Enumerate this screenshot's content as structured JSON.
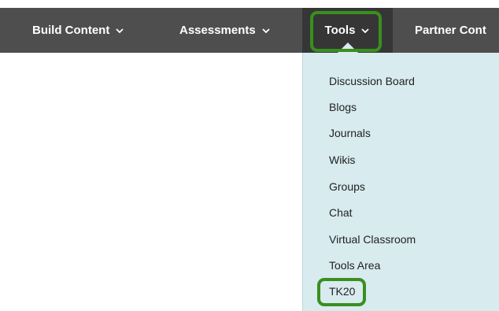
{
  "menubar": {
    "items": [
      {
        "label": "Build Content"
      },
      {
        "label": "Assessments"
      },
      {
        "label": "Tools"
      },
      {
        "label": "Partner Cont"
      }
    ]
  },
  "tools_menu": {
    "items": [
      {
        "label": "Discussion Board"
      },
      {
        "label": "Blogs"
      },
      {
        "label": "Journals"
      },
      {
        "label": "Wikis"
      },
      {
        "label": "Groups"
      },
      {
        "label": "Chat"
      },
      {
        "label": "Virtual Classroom"
      },
      {
        "label": "Tools Area"
      },
      {
        "label": "TK20"
      }
    ]
  },
  "colors": {
    "menubar_bg": "#4e4e4e",
    "active_tab_bg": "#363636",
    "dropdown_bg": "#d8ebef",
    "highlight": "#3a8f1f"
  },
  "icons": {
    "menu_chevron": "chevron-down-icon"
  }
}
